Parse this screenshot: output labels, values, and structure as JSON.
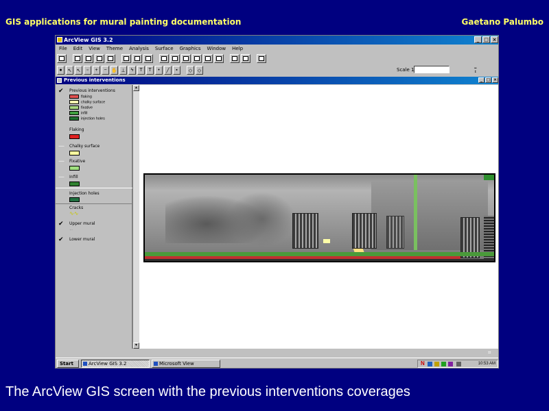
{
  "slide": {
    "title": "GIS applications for mural painting documentation",
    "author": "Gaetano Palumbo",
    "caption": "The ArcView GIS screen with the previous interventions coverages"
  },
  "app": {
    "title": "ArcView GIS 3.2",
    "min": "_",
    "max": "□",
    "close": "×",
    "menu": [
      "File",
      "Edit",
      "View",
      "Theme",
      "Analysis",
      "Surface",
      "Graphics",
      "Window",
      "Help"
    ],
    "scale_label": "Scale 1:",
    "scale_value": "",
    "coords": [
      "↔",
      "↕"
    ]
  },
  "view": {
    "title": "Previous interventions",
    "status_icon": "crosshair-icon"
  },
  "toc": {
    "themes": [
      {
        "name": "Previous interventions",
        "checked": true,
        "legend": [
          {
            "label": "flaking",
            "color": "#e05050"
          },
          {
            "label": "chalky surface",
            "color": "#ffffb0"
          },
          {
            "label": "fixative",
            "color": "#a8d880"
          },
          {
            "label": "infill",
            "color": "#40a040"
          },
          {
            "label": "injection holes",
            "color": "#207030"
          }
        ]
      },
      {
        "name": "Flaking",
        "checked": false,
        "swatch": "#e02020"
      },
      {
        "name": "Chalky surface",
        "checked": false,
        "swatch": "#ffffa0"
      },
      {
        "name": "Fixative",
        "checked": false,
        "swatch": "#a0e080"
      },
      {
        "name": "Infill",
        "checked": false,
        "swatch": "#308030"
      },
      {
        "name": "Injection holes",
        "checked": false,
        "swatch": "#207040"
      },
      {
        "name": "Cracks",
        "checked": false,
        "line": "yellow"
      },
      {
        "name": "Upper mural",
        "checked": true
      },
      {
        "name": "Lower mural",
        "checked": true
      }
    ]
  },
  "taskbar": {
    "start": "Start",
    "tasks": [
      "ArcView GIS 3.2",
      "Microsoft View"
    ],
    "clock": "10:53 AM",
    "colors": {
      "tray_n": "#cc0000"
    }
  }
}
